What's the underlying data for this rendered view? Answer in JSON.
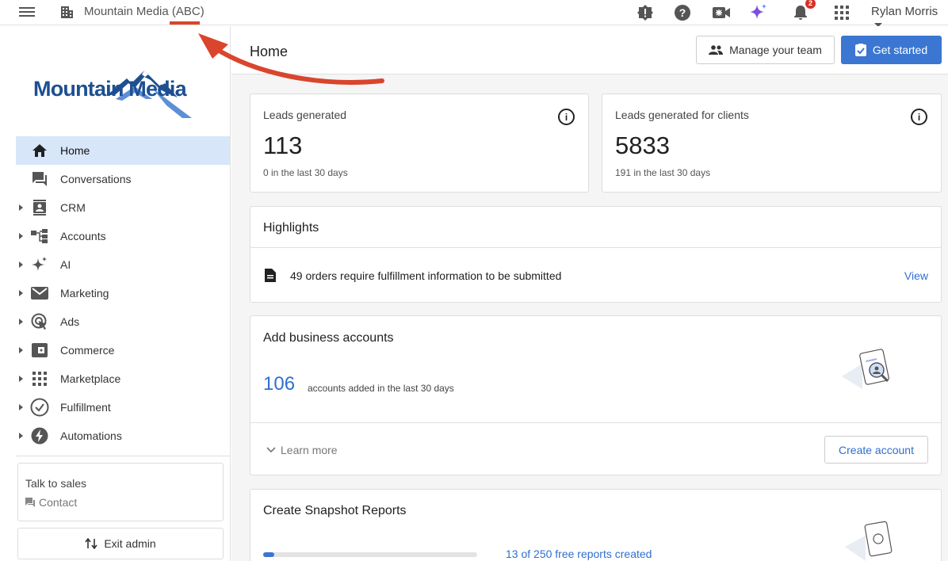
{
  "topbar": {
    "org_title": "Mountain Media (ABC)",
    "user_name": "Rylan Morris",
    "notification_count": "2",
    "icons": [
      "menu-icon",
      "building-icon",
      "alert-icon",
      "help-icon",
      "video-icon",
      "sparkle-icon",
      "bell-icon",
      "apps-grid-icon",
      "chevron-down-icon"
    ]
  },
  "logo": {
    "text": "Mountain Media"
  },
  "sidebar": {
    "items": [
      {
        "label": "Home",
        "icon": "home-icon",
        "active": true,
        "expandable": false
      },
      {
        "label": "Conversations",
        "icon": "chat-icon",
        "active": false,
        "expandable": false
      },
      {
        "label": "CRM",
        "icon": "contacts-icon",
        "active": false,
        "expandable": true
      },
      {
        "label": "Accounts",
        "icon": "hierarchy-icon",
        "active": false,
        "expandable": true
      },
      {
        "label": "AI",
        "icon": "sparkle-icon",
        "active": false,
        "expandable": true
      },
      {
        "label": "Marketing",
        "icon": "mail-icon",
        "active": false,
        "expandable": true
      },
      {
        "label": "Ads",
        "icon": "target-cursor-icon",
        "active": false,
        "expandable": true
      },
      {
        "label": "Commerce",
        "icon": "wallet-icon",
        "active": false,
        "expandable": true
      },
      {
        "label": "Marketplace",
        "icon": "grid-icon",
        "active": false,
        "expandable": true
      },
      {
        "label": "Fulfillment",
        "icon": "check-circle-icon",
        "active": false,
        "expandable": true
      },
      {
        "label": "Automations",
        "icon": "bolt-icon",
        "active": false,
        "expandable": true
      }
    ],
    "talk_to_sales": "Talk to sales",
    "contact": "Contact",
    "exit_admin": "Exit admin"
  },
  "header": {
    "title": "Home",
    "manage_team": "Manage your team",
    "get_started": "Get started"
  },
  "stats": [
    {
      "label": "Leads generated",
      "value": "113",
      "sub": "0 in the last 30 days"
    },
    {
      "label": "Leads generated for clients",
      "value": "5833",
      "sub": "191 in the last 30 days"
    }
  ],
  "highlights": {
    "title": "Highlights",
    "item_text": "49 orders require fulfillment information to be submitted",
    "link": "View"
  },
  "business_accounts": {
    "title": "Add business accounts",
    "count": "106",
    "sub": "accounts added in the last 30 days",
    "learn_more": "Learn more",
    "create": "Create account"
  },
  "snapshot": {
    "title": "Create Snapshot Reports",
    "count_text": "13 of 250 free reports created",
    "progress": 0.05
  },
  "colors": {
    "accent": "#3a76d2",
    "active_nav": "#d7e6f9",
    "annotation": "#d9452d",
    "badge": "#d93025"
  }
}
